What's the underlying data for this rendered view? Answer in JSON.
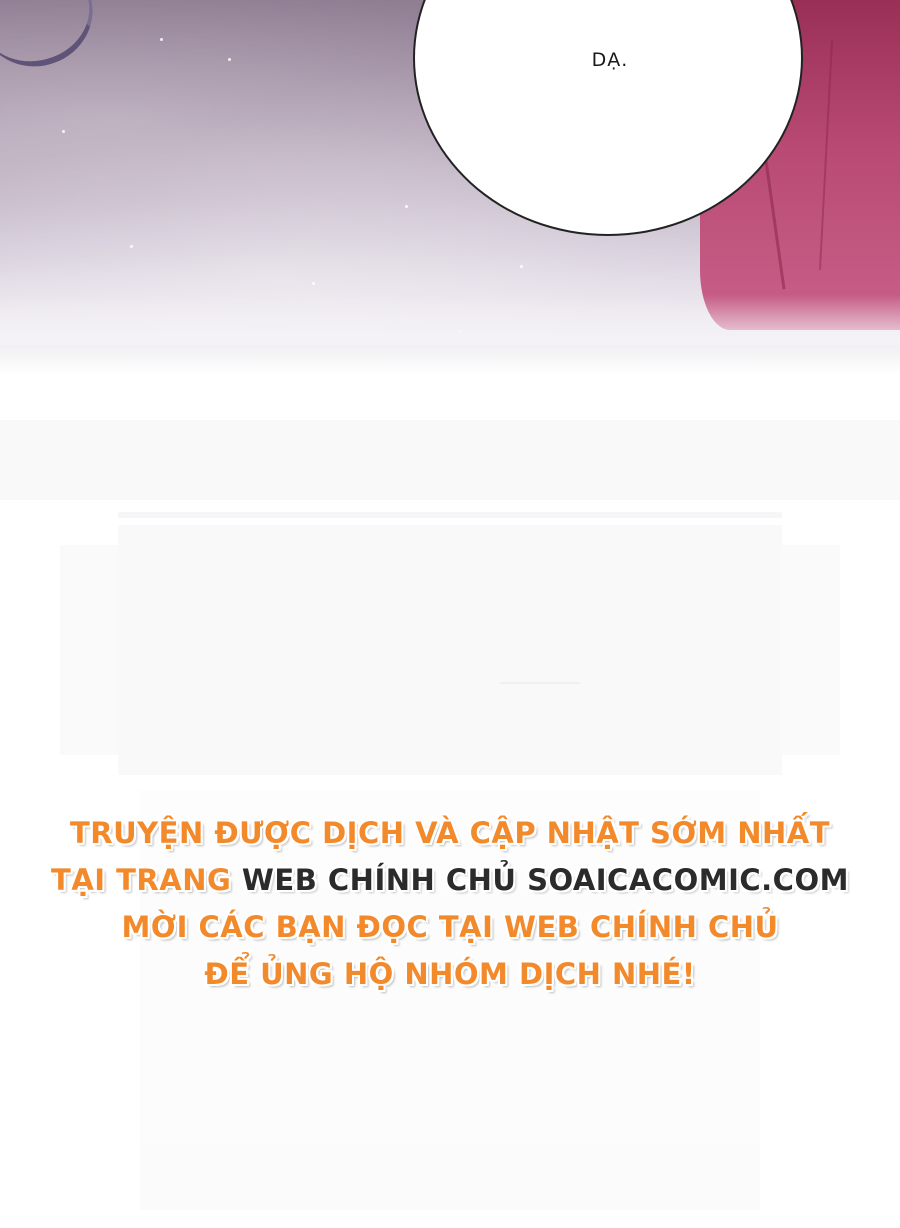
{
  "panel": {
    "speech_bubble_text": "DẠ."
  },
  "promo": {
    "line1": "TRUYỆN ĐƯỢC DỊCH VÀ CẬP NHẬT SỚM NHẤT",
    "line2_prefix": "TẠI TRANG",
    "line2_site": "WEB CHÍNH CHỦ SOAICACOMIC.COM",
    "line3": "MỜI CÁC BẠN ĐỌC TẠI WEB CHÍNH CHỦ",
    "line4": "ĐỂ ỦNG HỘ NHÓM DỊCH NHÉ!"
  },
  "colors": {
    "promo_orange": "#f28a2c",
    "promo_dark": "#2b2b2b",
    "robe": "#b84a73",
    "sky": "#a897ab"
  }
}
